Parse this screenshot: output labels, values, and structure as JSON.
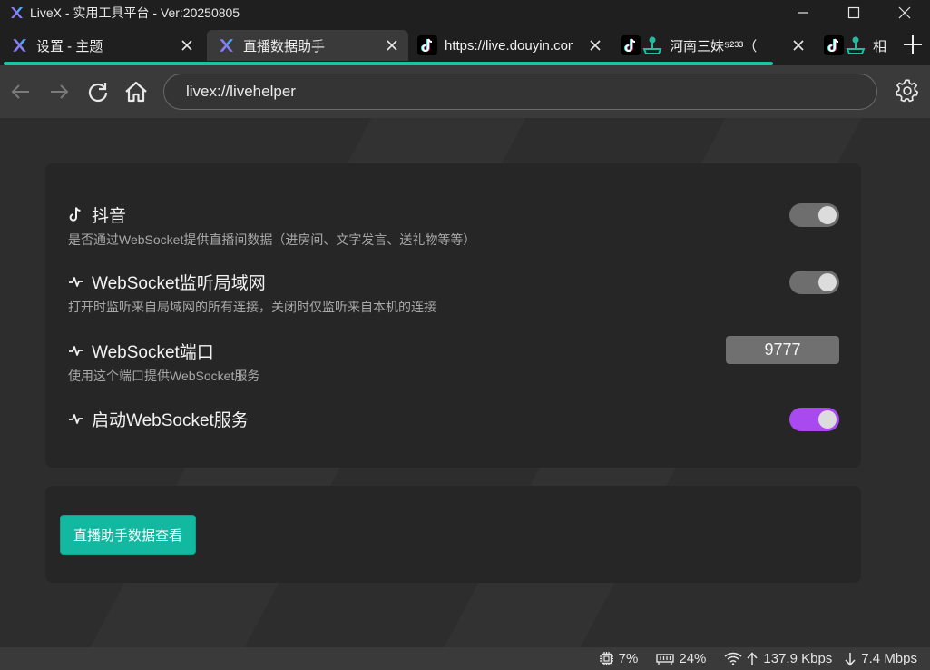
{
  "window": {
    "title": "LiveX - 实用工具平台 - Ver:20250805"
  },
  "tabs": [
    {
      "label": "设置 - 主题",
      "active": false
    },
    {
      "label": "直播数据助手",
      "active": true
    },
    {
      "label": "https://live.douyin.com",
      "active": false
    },
    {
      "label": "河南三妹⁵²³³（",
      "active": false
    },
    {
      "label": "相",
      "active": false
    }
  ],
  "nav": {
    "url": "livex://livehelper"
  },
  "settings": {
    "douyin": {
      "title": "抖音",
      "desc": "是否通过WebSocket提供直播间数据（进房间、文字发言、送礼物等等）",
      "enabled": false
    },
    "lan": {
      "title": "WebSocket监听局域网",
      "desc": "打开时监听来自局域网的所有连接，关闭时仅监听来自本机的连接",
      "enabled": false
    },
    "port": {
      "title": "WebSocket端口",
      "desc": "使用这个端口提供WebSocket服务",
      "value": "9777"
    },
    "service": {
      "title": "启动WebSocket服务",
      "enabled": true
    }
  },
  "actions": {
    "view_data_label": "直播助手数据查看"
  },
  "status": {
    "cpu": "7%",
    "memory": "24%",
    "upload": "137.9 Kbps",
    "download": "7.4 Mbps"
  },
  "colors": {
    "accent": "#13b8a0",
    "toggle_on": "#a94af0",
    "toggle_off": "#6e6e6e",
    "progress": "#17c5a4"
  }
}
